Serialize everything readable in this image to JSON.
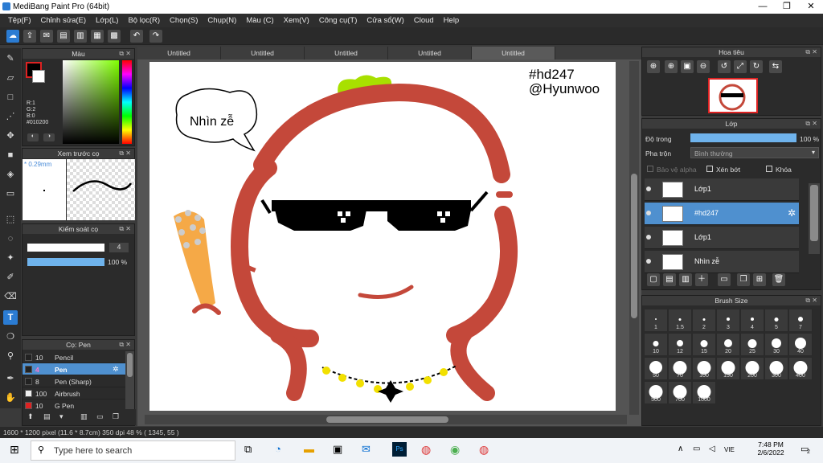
{
  "window": {
    "title": "MediBang Paint Pro (64bit)",
    "minimize": "—",
    "maximize": "❐",
    "close": "✕"
  },
  "menu": [
    "Tệp(F)",
    "Chỉnh sửa(E)",
    "Lớp(L)",
    "Bộ lọc(R)",
    "Chọn(S)",
    "Chụp(N)",
    "Màu (C)",
    "Xem(V)",
    "Công cụ(T)",
    "Cửa sổ(W)",
    "Cloud",
    "Help"
  ],
  "tabs": [
    "Untitled",
    "Untitled",
    "Untitled",
    "Untitled",
    "Untitled"
  ],
  "active_tab": 4,
  "color_panel": {
    "title": "Màu",
    "r": "R:1",
    "g": "G:2",
    "b": "B:0",
    "hex": "#010200",
    "primary": "#010200"
  },
  "brush_preview": {
    "title": "Xem trước cọ",
    "size": "0.29mm"
  },
  "brush_control": {
    "title": "Kiểm soát cọ",
    "size_value": "4",
    "opacity_value": "100 %",
    "opacity": 1.0
  },
  "brush_list": {
    "title": "Cọ: Pen",
    "items": [
      {
        "size": "10",
        "name": "Pencil",
        "color": "#222222"
      },
      {
        "size": "4",
        "name": "Pen",
        "color": "#222222",
        "selected": true
      },
      {
        "size": "8",
        "name": "Pen (Sharp)",
        "color": "#222222"
      },
      {
        "size": "100",
        "name": "Airbrush",
        "color": "#eeeeee"
      },
      {
        "size": "10",
        "name": "G Pen",
        "color": "#dd2222"
      }
    ]
  },
  "navigator": {
    "title": "Hoa tiêu"
  },
  "layer_panel": {
    "title": "Lớp",
    "opacity_label": "Độ trong",
    "opacity_value": "100 %",
    "blend_label": "Pha trộn",
    "blend_value": "Bình thường",
    "protect_alpha": "Bảo vệ alpha",
    "clipping": "Xén bớt",
    "lock": "Khóa",
    "layers": [
      {
        "name": "Lớp1",
        "selected": false
      },
      {
        "name": "#hd247",
        "selected": true
      },
      {
        "name": "Lớp1",
        "selected": false
      },
      {
        "name": "Nhìn zễ",
        "selected": false
      }
    ]
  },
  "brush_size": {
    "title": "Brush Size",
    "sizes": [
      "1",
      "1.5",
      "2",
      "3",
      "4",
      "5",
      "7",
      "10",
      "12",
      "15",
      "20",
      "25",
      "30",
      "40",
      "50",
      "70",
      "100",
      "150",
      "200",
      "300",
      "400",
      "500",
      "700",
      "1000"
    ]
  },
  "canvas_text": {
    "speech": "Nhìn zễ",
    "tag1": "#hd247",
    "tag2": "@Hyunwoo"
  },
  "status": "1600 * 1200 pixel  (11.6 * 8.7cm)  350 dpi  48 %  ( 1345, 55 )",
  "taskbar": {
    "search_placeholder": "Type here to search",
    "lang": "VIE",
    "time": "7:48 PM",
    "date": "2/6/2022",
    "notif": "2"
  }
}
